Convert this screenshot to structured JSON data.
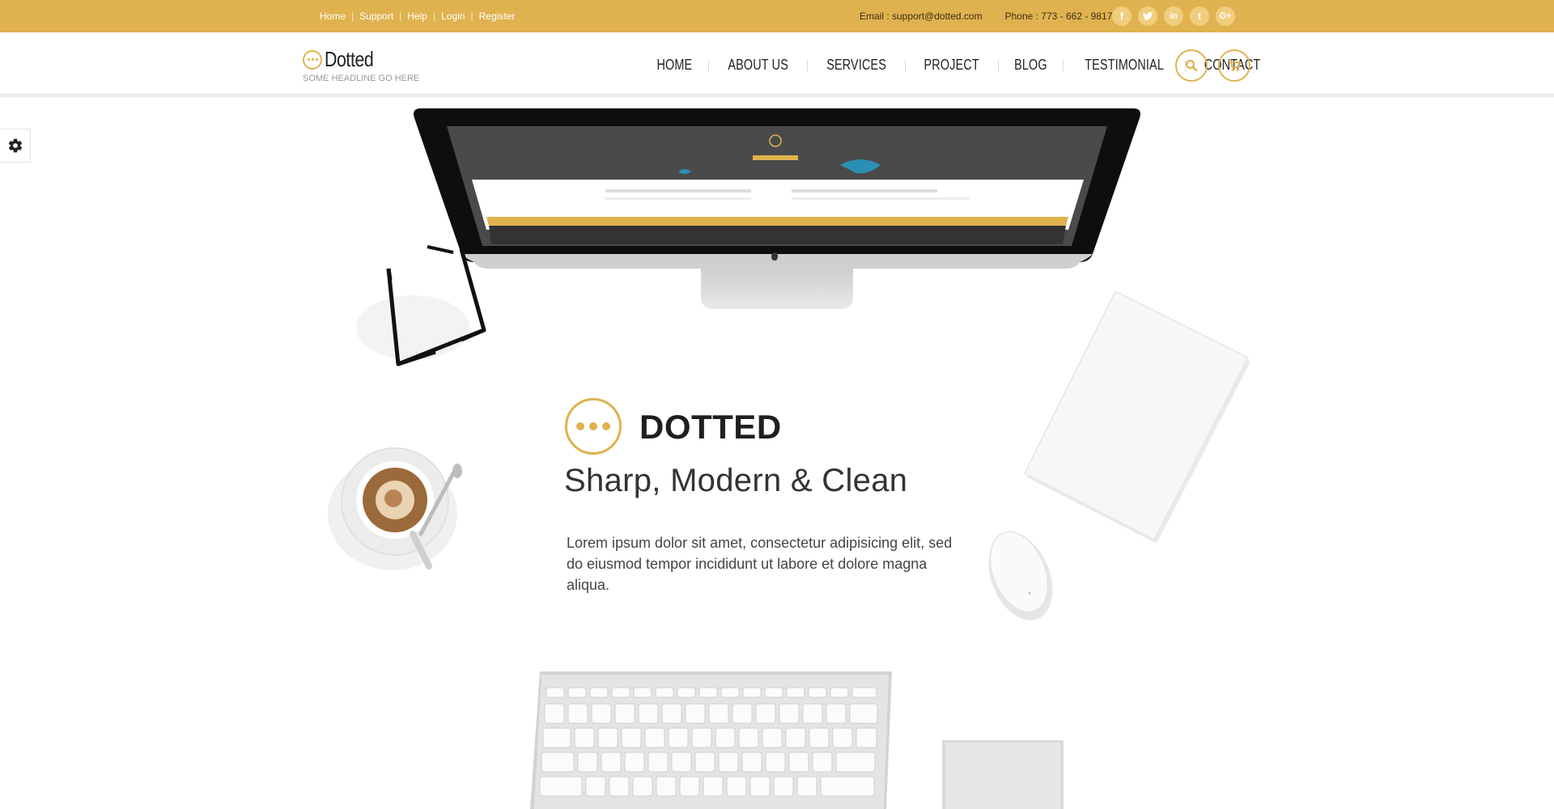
{
  "topbar": {
    "links": [
      "Home",
      "Support",
      "Help",
      "Login",
      "Register"
    ],
    "email": "Email : support@dotted.com",
    "phone": "Phone : 773 - 662 - 9817",
    "social_icons": [
      "facebook-icon",
      "twitter-icon",
      "linkedin-icon",
      "tumblr-icon",
      "google-plus-icon"
    ]
  },
  "header": {
    "logo_name": "Dotted",
    "logo_tagline": "SOME HEADLINE GO HERE",
    "nav": [
      "HOME",
      "ABOUT US",
      "SERVICES",
      "PROJECT",
      "BLOG",
      "TESTIMONIAL",
      "CONTACT"
    ],
    "search_icon": "search-icon",
    "cart_icon": "cart-icon"
  },
  "settings_icon": "gear-icon",
  "hero": {
    "title": "DOTTED",
    "subtitle": "Sharp, Modern & Clean",
    "text": "Lorem ipsum dolor sit amet, consectetur adipisicing elit, sed do eiusmod tempor incididunt ut labore et dolore magna aliqua."
  },
  "colors": {
    "accent": "#e0b24f",
    "dark": "#222222"
  }
}
